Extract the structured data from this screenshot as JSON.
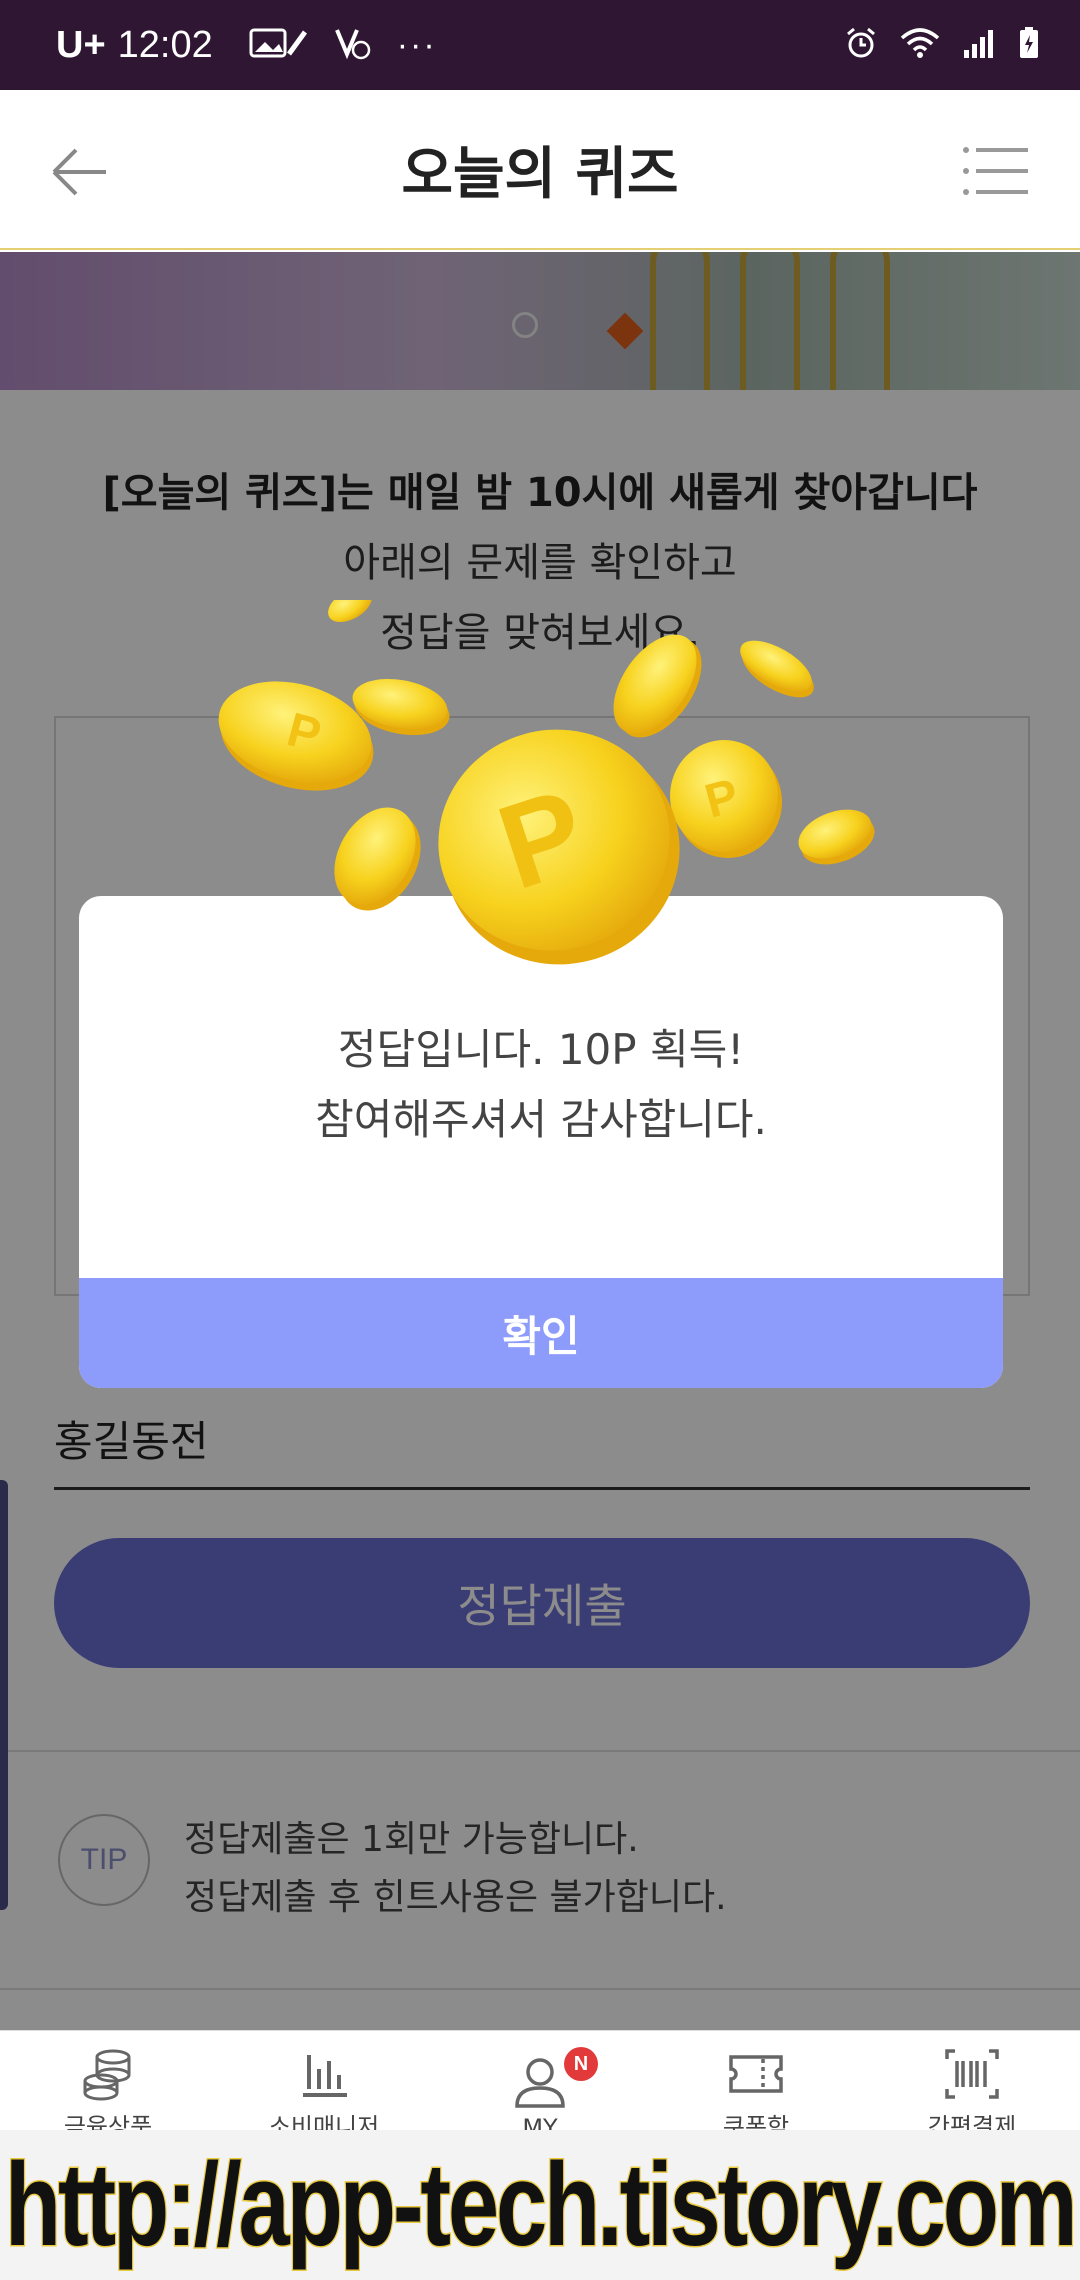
{
  "status_bar": {
    "carrier": "U+",
    "time": "12:02",
    "more": "···"
  },
  "header": {
    "title": "오늘의 퀴즈"
  },
  "intro": {
    "line1": "[오늘의 퀴즈]는 매일 밤 10시에 새롭게 찾아갑니다",
    "line2": "아래의 문제를 확인하고",
    "line3": "정답을 맞혀보세요."
  },
  "answer": {
    "value": "홍길동전"
  },
  "submit": {
    "label": "정답제출"
  },
  "tip": {
    "badge": "TIP",
    "line1": "정답제출은 1회만 가능합니다.",
    "line2": "정답제출 후 힌트사용은 불가합니다."
  },
  "modal": {
    "line1": "정답입니다. 10P 획득!",
    "line2": "참여해주셔서 감사합니다.",
    "confirm_label": "확인"
  },
  "bottom_nav": {
    "items": [
      {
        "label": "금융상품",
        "icon": "coins-stack-icon"
      },
      {
        "label": "소비매니저",
        "icon": "bar-chart-icon"
      },
      {
        "label": "MY",
        "icon": "person-icon",
        "badge": "N"
      },
      {
        "label": "쿠폰함",
        "icon": "ticket-icon"
      },
      {
        "label": "간편결제",
        "icon": "barcode-icon"
      }
    ]
  },
  "watermark": {
    "text": "http://app-tech.tistory.com"
  },
  "colors": {
    "status_bar": "#2f1632",
    "modal_button": "#8d9bfb",
    "submit_button": "#6b6fd3",
    "coin": "#f7d21e",
    "badge": "#e23a3a"
  }
}
